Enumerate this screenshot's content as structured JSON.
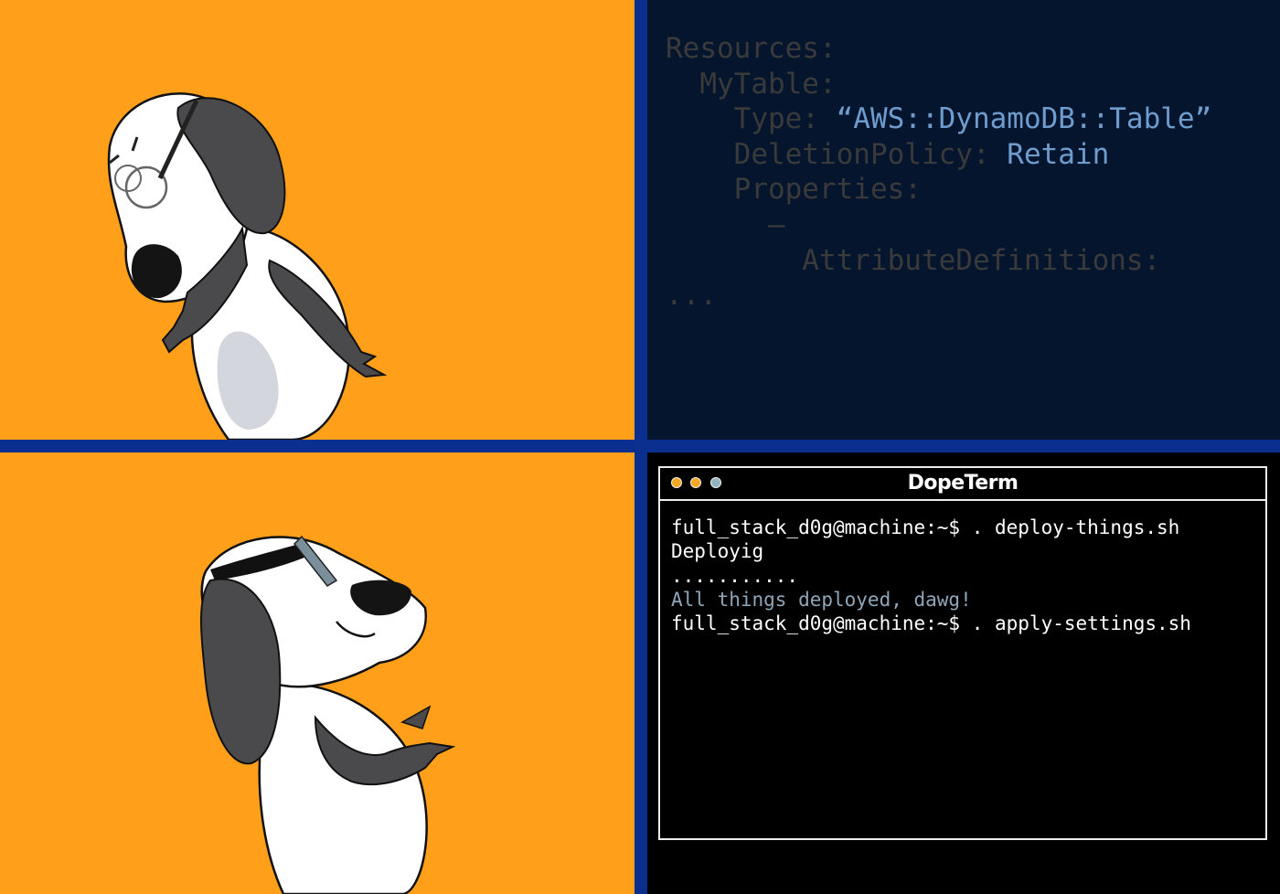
{
  "code_panel": {
    "lines": [
      {
        "key": "Resources:",
        "value": ""
      },
      {
        "key": "  MyTable:",
        "value": ""
      },
      {
        "key": "    Type: ",
        "value": "“AWS::DynamoDB::Table”"
      },
      {
        "key": "    DeletionPolicy: ",
        "value": "Retain"
      },
      {
        "key": "    Properties:",
        "value": ""
      },
      {
        "key": "      –",
        "value": ""
      },
      {
        "key": "        AttributeDefinitions:",
        "value": ""
      },
      {
        "key": "...",
        "value": ""
      }
    ]
  },
  "terminal": {
    "title": "DopeTerm",
    "lines": [
      "full_stack_d0g@machine:~$ . deploy-things.sh",
      "Deployig",
      "...........",
      "All things deployed, dawg!",
      "full_stack_d0g@machine:~$ . apply-settings.sh"
    ],
    "colors": {
      "dot_1": "#f5a623",
      "dot_2": "#f5a623",
      "dot_3": "#8fb6c0",
      "success_text": "#8fa6b8"
    }
  },
  "colors": {
    "panel_orange": "#ff9f1a",
    "divider_blue": "#0a2f8f",
    "code_bg": "#04152d",
    "code_value": "#6f9ccf"
  }
}
